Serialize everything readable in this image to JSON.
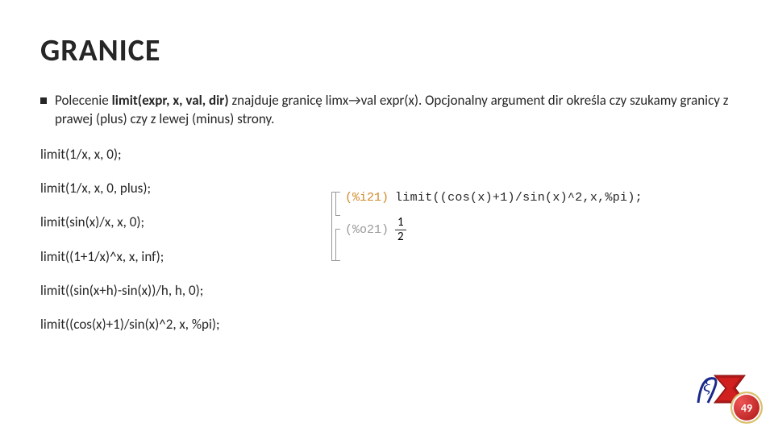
{
  "title": "GRANICE",
  "bullet": {
    "pre": "Polecenie ",
    "bold": "limit(expr, x, val, dir)",
    "post": " znajduje granicę limx→val expr(x). Opcjonalny argument dir określa czy szukamy granicy z prawej (plus) czy z lewej (minus) strony."
  },
  "examples": [
    "limit(1/x, x, 0);",
    "limit(1/x, x, 0, plus);",
    "limit(sin(x)/x, x, 0);",
    "limit((1+1/x)^x, x, inf);",
    "limit((sin(x+h)-sin(x))/h, h, 0);",
    "limit((cos(x)+1)/sin(x)^2, x, %pi);"
  ],
  "maxima": {
    "in_label": "(%i21)",
    "in_code": "limit((cos(x)+1)/sin(x)^2,x,%pi);",
    "out_label": "(%o21)",
    "out_num": "1",
    "out_den": "2"
  },
  "page_number": "49"
}
